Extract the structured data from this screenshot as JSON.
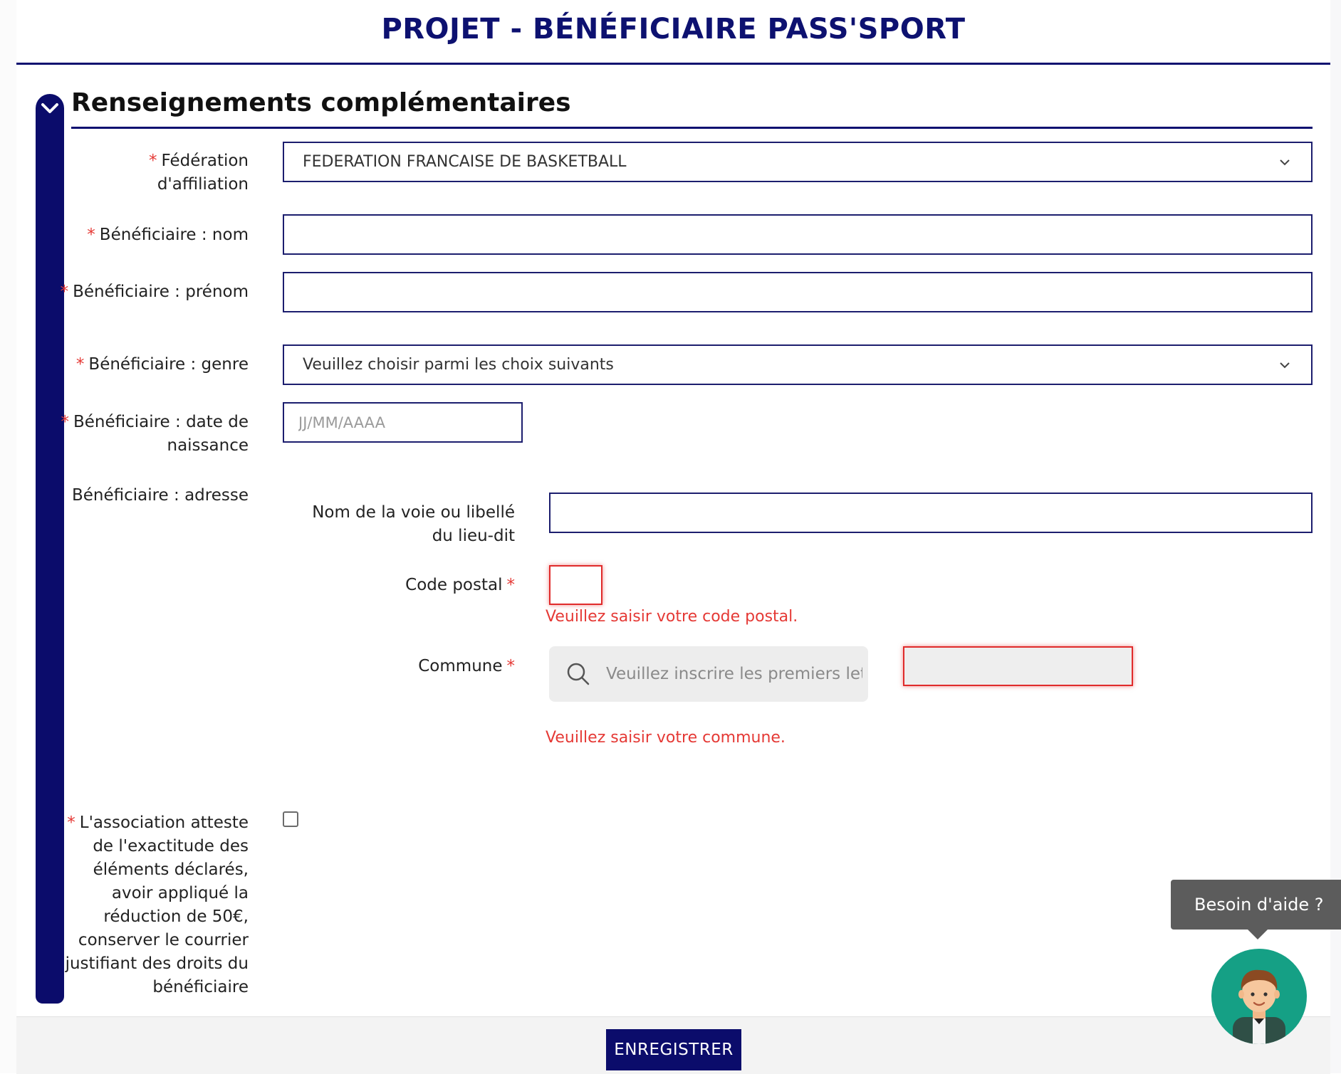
{
  "header": {
    "title": "PROJET - BÉNÉFICIAIRE PASS'SPORT"
  },
  "section": {
    "title": "Renseignements complémentaires"
  },
  "required_mark": "*",
  "form": {
    "federation": {
      "label": "Fédération d'affiliation",
      "value": "FEDERATION FRANCAISE DE BASKETBALL"
    },
    "nom": {
      "label": "Bénéficiaire : nom",
      "value": ""
    },
    "prenom": {
      "label": "Bénéficiaire : prénom",
      "value": ""
    },
    "genre": {
      "label": "Bénéficiaire : genre",
      "value": "Veuillez choisir parmi les choix suivants"
    },
    "naissance": {
      "label": "Bénéficiaire : date de naissance",
      "placeholder": "JJ/MM/AAAA"
    },
    "adresse": {
      "label": "Bénéficiaire : adresse",
      "voie": {
        "label": "Nom de la voie ou libellé du lieu-dit",
        "value": ""
      },
      "code_postal": {
        "label": "Code postal",
        "value": "",
        "error": "Veuillez saisir votre code postal."
      },
      "commune": {
        "label": "Commune",
        "search_placeholder": "Veuillez inscrire les premiers lett",
        "error": "Veuillez saisir votre commune."
      }
    },
    "attestation": {
      "label": "L'association atteste de l'exactitude des éléments déclarés, avoir appliqué la réduction de 50€, conserver le courrier justifiant des droits du bénéficiaire",
      "checked": false
    }
  },
  "footer": {
    "submit_label": "ENREGISTRER"
  },
  "help": {
    "label": "Besoin d'aide ?"
  },
  "colors": {
    "brand": "#0b0c6b",
    "error": "#e53935",
    "help_avatar_bg": "#15a085"
  }
}
